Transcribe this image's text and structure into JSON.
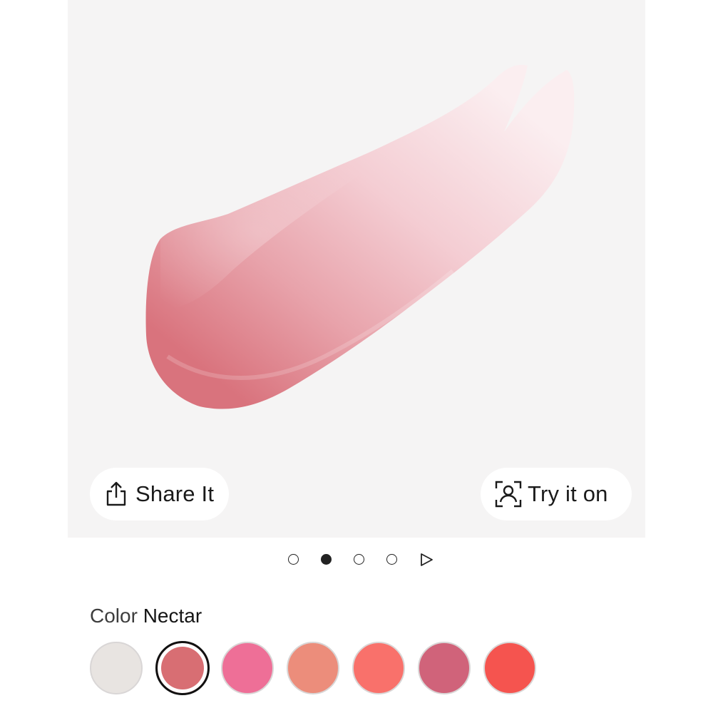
{
  "actions": {
    "share_label": "Share It",
    "try_on_label": "Try it on"
  },
  "carousel": {
    "slide_count": 4,
    "active_index": 1,
    "has_video": true
  },
  "color": {
    "label": "Color",
    "selected_name": "Nectar",
    "swatches": [
      {
        "hex": "#e8e4e1",
        "selected": false
      },
      {
        "hex": "#d86e73",
        "selected": true
      },
      {
        "hex": "#ee6f97",
        "selected": false
      },
      {
        "hex": "#ec8d7b",
        "selected": false
      },
      {
        "hex": "#f9716b",
        "selected": false
      },
      {
        "hex": "#d0637a",
        "selected": false
      },
      {
        "hex": "#f5544f",
        "selected": false
      }
    ]
  },
  "theme": {
    "gallery_bg": "#f5f4f4",
    "product_pink": "#e8a0a8"
  }
}
